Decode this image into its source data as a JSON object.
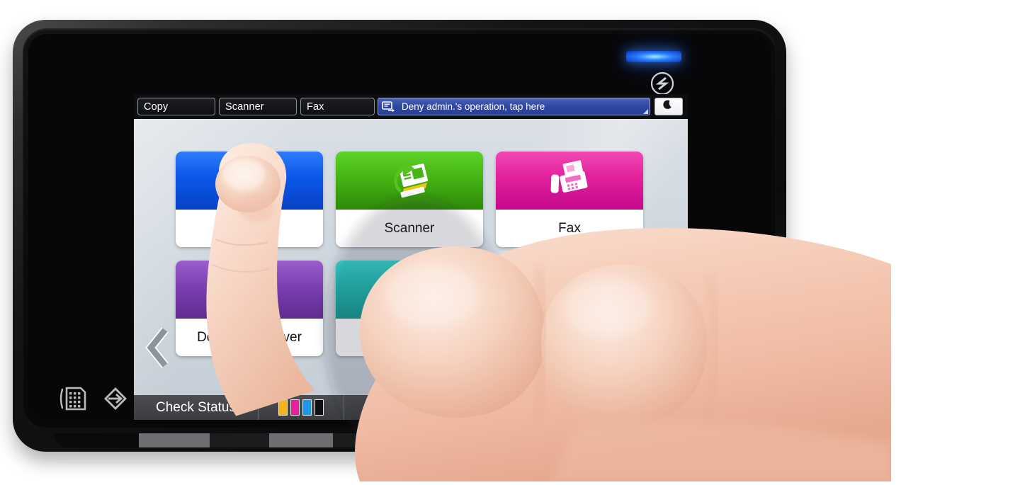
{
  "device": {
    "name": "mfp-control-panel",
    "power_button_icon": "power-icon",
    "led_indicator": "status-led",
    "nfc_icon": "nfc-smart-device-icon",
    "hardware_keys": [
      {
        "name": "numeric-keypad-key",
        "icon": "keypad-icon"
      },
      {
        "name": "login-logout-key",
        "icon": "login-key-icon"
      },
      {
        "name": "information-key",
        "icon": "information-icon"
      }
    ]
  },
  "screen": {
    "tabs": [
      {
        "label": "Copy",
        "name": "tab-copy"
      },
      {
        "label": "Scanner",
        "name": "tab-scanner"
      },
      {
        "label": "Fax",
        "name": "tab-fax"
      }
    ],
    "notification": {
      "text": "Deny admin.'s operation, tap here",
      "icon": "message-transfer-icon",
      "resize_handle": "resize-corner-handle",
      "bg_color": "#2f47a0"
    },
    "sleep_button": {
      "icon": "crescent-moon-icon",
      "name": "sleep-mode-button"
    },
    "nav": {
      "prev_icon": "chevron-left-icon",
      "next_icon": "chevron-right-icon",
      "page_dots": 2,
      "active_page": 1
    },
    "tiles": [
      {
        "label": "",
        "name": "tile-copy",
        "icon": "copy-icon",
        "color": "#0b57e8",
        "color_dark": "#0742c4",
        "label_hidden_by_hand": true
      },
      {
        "label": "Scanner",
        "name": "tile-scanner",
        "icon": "scanner-icon",
        "color": "#45b414",
        "color_dark": "#2e8a07"
      },
      {
        "label": "Fax",
        "name": "tile-fax",
        "icon": "fax-icon",
        "color": "#e2219b",
        "color_dark": "#c4088a"
      },
      {
        "label": "Document Server",
        "name": "tile-document-server",
        "icon": "document-server-icon",
        "color": "#7b3fb0",
        "color_dark": "#612b91"
      },
      {
        "label": "",
        "name": "tile-printer",
        "icon": "printer-icon",
        "color": "#1fb9b2",
        "color_dark": "#13988f",
        "label_hidden_by_hand": true
      }
    ],
    "status_bar": {
      "check_status_label": "Check Status",
      "back_icon": "back-arrow-icon",
      "home_button": "home-button",
      "toner": [
        {
          "name": "toner-yellow",
          "color": "#f5b323"
        },
        {
          "name": "toner-magenta",
          "color": "#e8219b"
        },
        {
          "name": "toner-cyan",
          "color": "#2196e8"
        },
        {
          "name": "toner-black",
          "color": "#111111"
        }
      ]
    }
  },
  "overlay": {
    "hand": {
      "name": "human-hand-touching-screen",
      "target_tile": "tile-copy"
    }
  }
}
